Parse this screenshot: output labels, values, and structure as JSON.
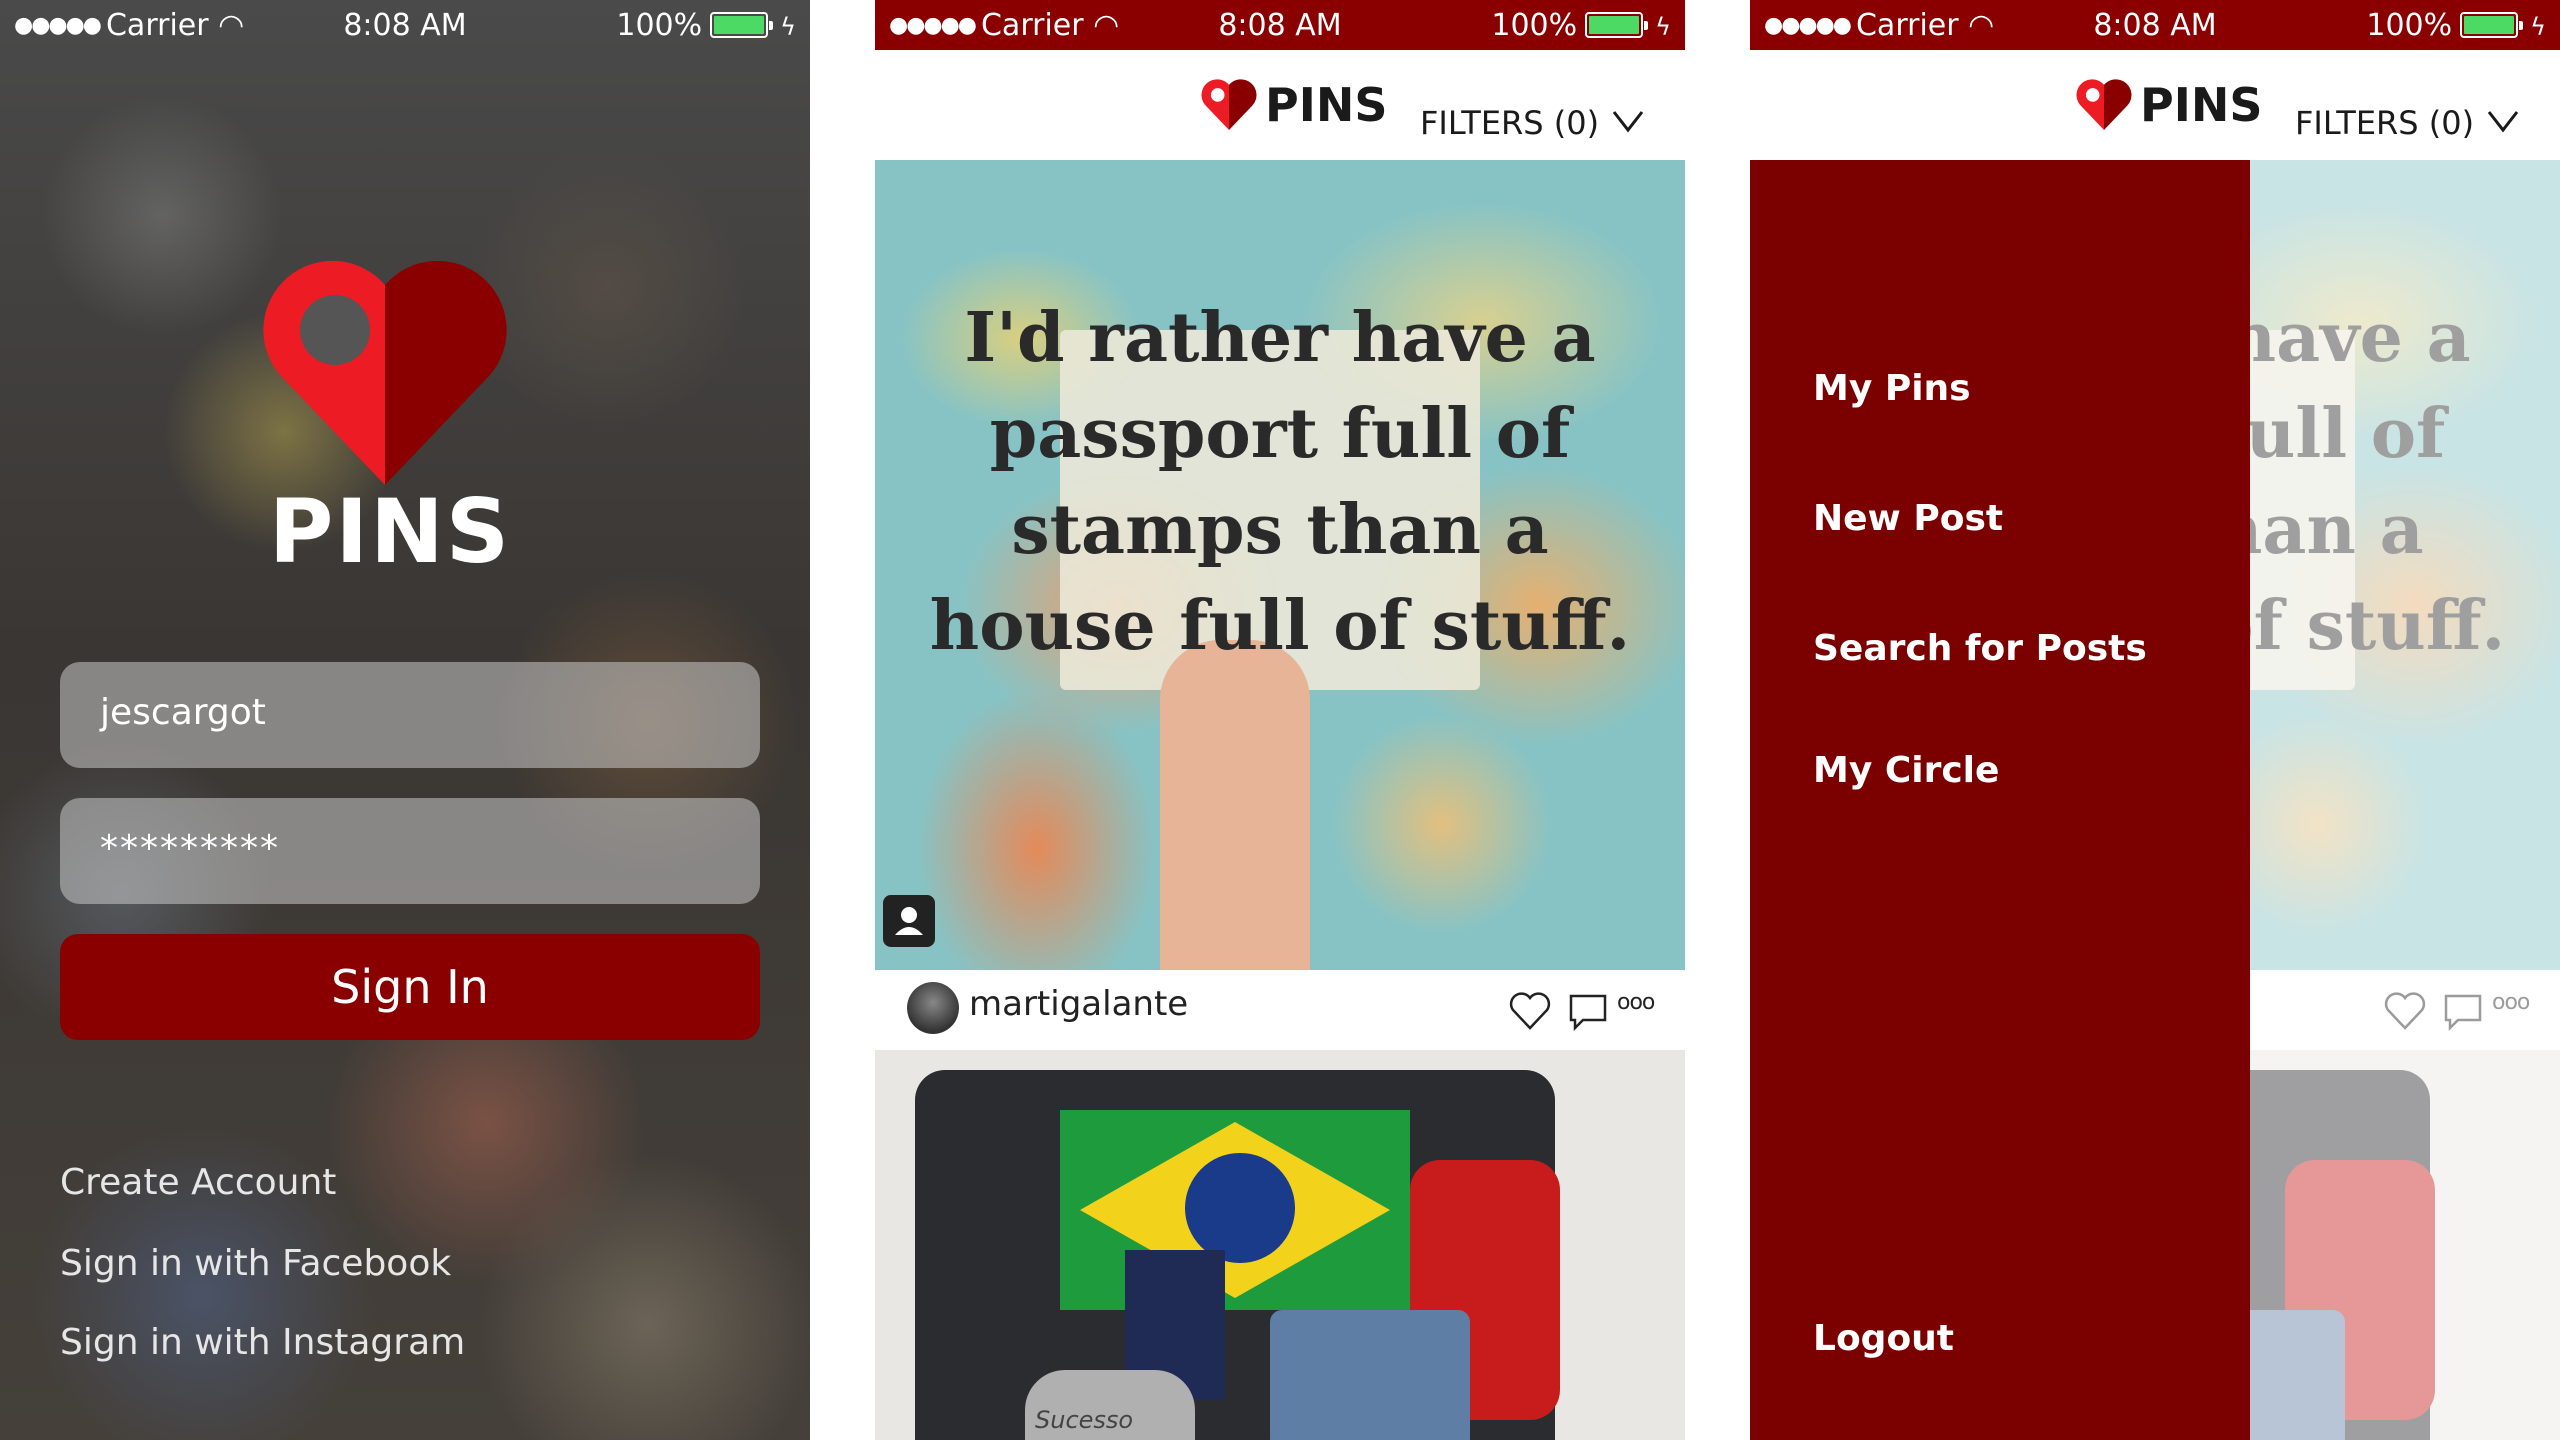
{
  "status": {
    "carrier": "Carrier",
    "time": "8:08 AM",
    "battery": "100%",
    "battery_color": "#4cd964"
  },
  "brand": {
    "name": "PINS",
    "accent_color": "#8a0000",
    "logo_light": "#ed1c24",
    "logo_dark": "#8a0000"
  },
  "login": {
    "username": "jescargot",
    "password": "*********",
    "sign_in": "Sign In",
    "create_account": "Create Account",
    "facebook": "Sign in with Facebook",
    "instagram": "Sign in with Instagram"
  },
  "feed": {
    "filters": "FILTERS (0)",
    "post1": {
      "quote": "I'd rather have a passport full of stamps than a house full of stuff.",
      "user": "martigalante",
      "icons": [
        "heart-icon",
        "comment-icon",
        "more-icon"
      ],
      "more": "ooo"
    },
    "post2": {
      "caption": "Sucesso"
    }
  },
  "menu": {
    "items": [
      "My Pins",
      "New Post",
      "Search for Posts",
      "My Circle"
    ],
    "logout": "Logout"
  }
}
